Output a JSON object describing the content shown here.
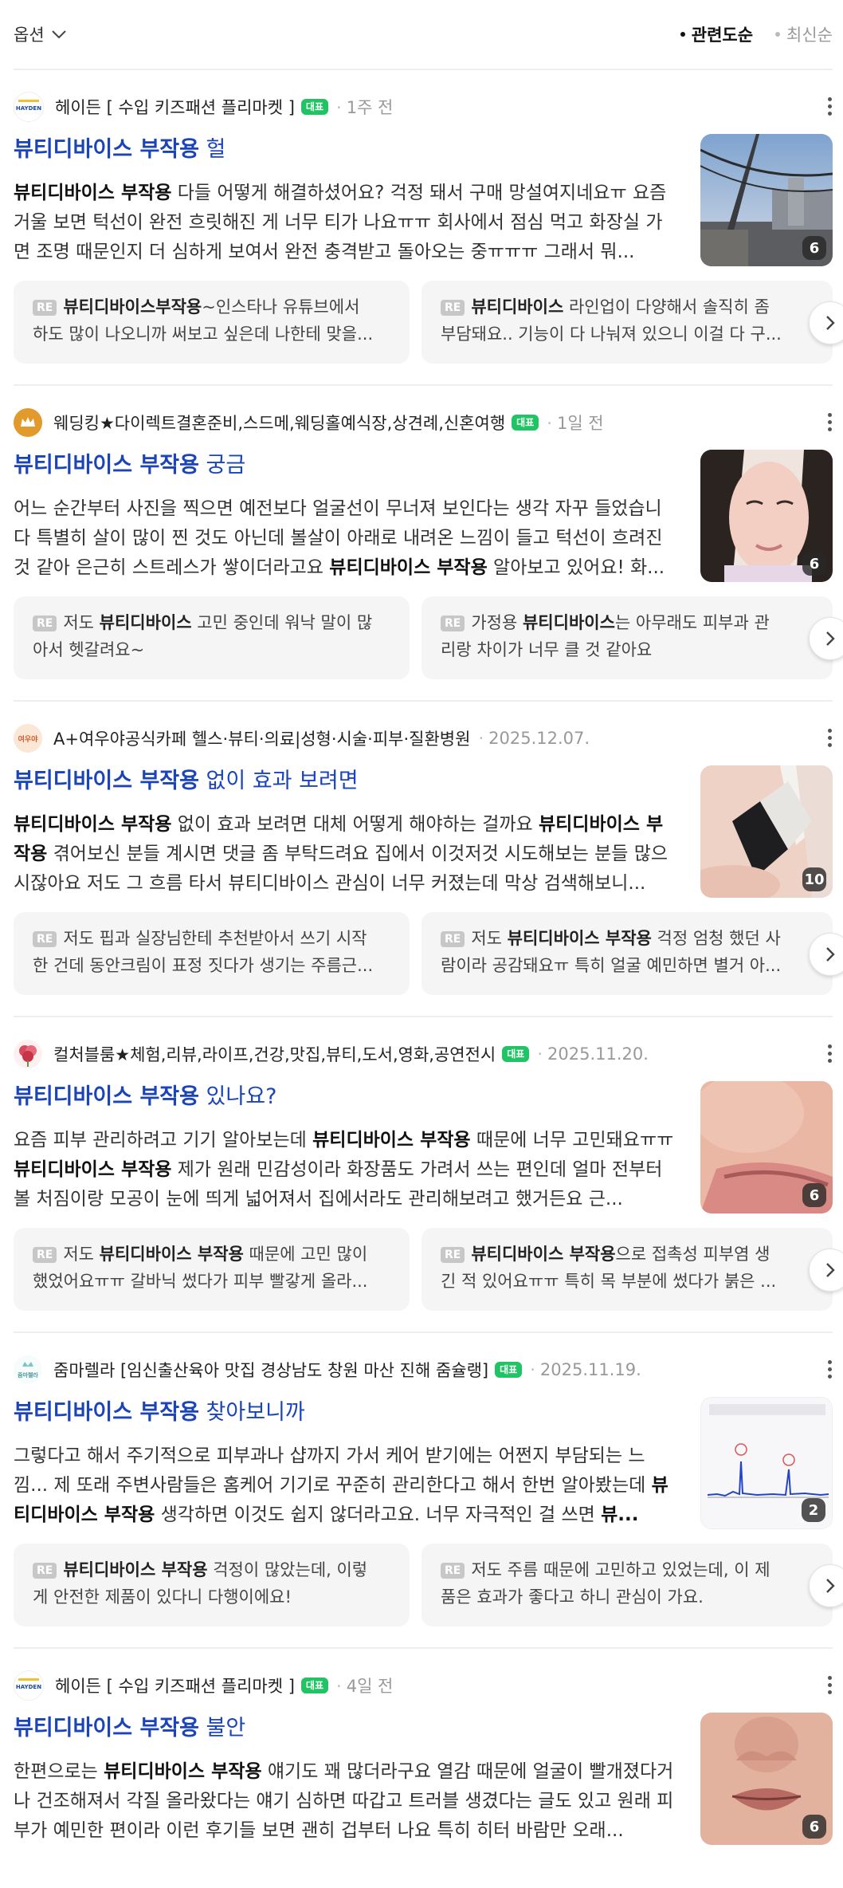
{
  "header": {
    "options_label": "옵션",
    "sort_relevance": "관련도순",
    "sort_latest": "최신순"
  },
  "icons": {
    "options_toggle": "chevron-down-icon",
    "more_menu": "more-vertical-icon",
    "next_arrow": "chevron-right-icon"
  },
  "colors": {
    "title_blue": "#1a44b8",
    "badge_green": "#21c464",
    "reply_bg": "#f5f5f5"
  },
  "cards": [
    {
      "source": "헤이든 [ 수입 키즈패션 플리마켓 ]",
      "avatar_text": "HAYDEN",
      "badge": "대표",
      "time": "1주 전",
      "title_bold": "뷰티디바이스 부작용",
      "title_rest": " 헐",
      "desc_html": "<b>뷰티디바이스 부작용</b> 다들 어떻게 해결하셨어요? 걱정 돼서 구매 망설여지네요ㅠ 요즘 거울 보면 턱선이 완전 흐릿해진 게 너무 티가 나요ㅠㅠ 회사에서 점심 먹고 화장실 가면 조명 때문인지 더 심하게 보여서 완전 충격받고 돌아오는 중ㅠㅠㅠ 그래서 뭐...",
      "image_count": "6",
      "reply1_l1_bold": "뷰티디바이스부작용",
      "reply1_l1_rest": "~인스타나 유튜브에서",
      "reply1_l2": "하도 많이 나오니까 써보고 싶은데 나한테 맞을...",
      "reply2_l1_bold": "뷰티디바이스",
      "reply2_l1_rest": " 라인업이 다양해서 솔직히 좀",
      "reply2_l2": "부담돼요.. 기능이 다 나눠져 있으니 이걸 다 구..."
    },
    {
      "source": "웨딩킹★다이렉트결혼준비,스드메,웨딩홀예식장,상견례,신혼여행",
      "avatar_text": "",
      "badge": "대표",
      "time": "1일 전",
      "title_bold": "뷰티디바이스 부작용",
      "title_rest": " 궁금",
      "desc_html": "어느 순간부터 사진을 찍으면 예전보다 얼굴선이 무너져 보인다는 생각 자꾸 들었습니다 특별히 살이 많이 찐 것도 아닌데 볼살이 아래로 내려온 느낌이 들고 턱선이 흐려진 것 같아 은근히 스트레스가 쌓이더라고요 <b>뷰티디바이스 부작용</b> 알아보고 있어요! 화...",
      "image_count": "6",
      "reply1_l1_bold": "뷰티디바이스",
      "reply1_l1_pre": "저도 ",
      "reply1_l1_rest": " 고민 중인데 워낙 말이 많",
      "reply1_l2": "아서 헷갈려요~",
      "reply2_l1_pre": "가정용 ",
      "reply2_l1_bold": "뷰티디바이스",
      "reply2_l1_rest": "는 아무래도 피부과 관",
      "reply2_l2": "리랑 차이가 너무 클 것 같아요"
    },
    {
      "source": "A+여우야공식카페 헬스·뷰티·의료|성형·시술·피부·질환병원",
      "avatar_text": "여우야",
      "badge": "",
      "time": "2025.12.07.",
      "title_bold": "뷰티디바이스 부작용",
      "title_rest": " 없이 효과 보려면",
      "desc_html": "<b>뷰티디바이스 부작용</b> 없이 효과 보려면 대체 어떻게 해야하는 걸까요 <b>뷰티디바이스 부작용</b> 겪어보신 분들 계시면 댓글 좀 부탁드려요 집에서 이것저것 시도해보는 분들 많으시잖아요 저도 그 흐름 타서 뷰티디바이스 관심이 너무 커졌는데 막상 검색해보니...",
      "image_count": "10",
      "reply1_l1_pre": "저도 핍과 실장님한테 추천받아서 쓰기 시작",
      "reply1_l2": "한 건데 동안크림이 표정 짓다가 생기는 주름근...",
      "reply2_l1_pre": "저도 ",
      "reply2_l1_bold": "뷰티디바이스 부작용",
      "reply2_l1_rest": " 걱정 엄청 했던 사",
      "reply2_l2": "람이라 공감돼요ㅠ 특히 얼굴 예민하면 별거 아..."
    },
    {
      "source": "컬처블룸★체험,리뷰,라이프,건강,맛집,뷰티,도서,영화,공연전시",
      "avatar_text": "",
      "badge": "대표",
      "time": "2025.11.20.",
      "title_bold": "뷰티디바이스 부작용",
      "title_rest": " 있나요?",
      "desc_html": "요즘 피부 관리하려고 기기 알아보는데 <b>뷰티디바이스 부작용</b> 때문에 너무 고민돼요ㅠㅠ <b>뷰티디바이스 부작용</b> 제가 원래 민감성이라 화장품도 가려서 쓰는 편인데 얼마 전부터 볼 처짐이랑 모공이 눈에 띄게 넓어져서 집에서라도 관리해보려고 했거든요 근...",
      "image_count": "6",
      "reply1_l1_pre": "저도 ",
      "reply1_l1_bold": "뷰티디바이스 부작용",
      "reply1_l1_rest": " 때문에 고민 많이",
      "reply1_l2": "했었어요ㅠㅠ 갈바닉 썼다가 피부 빨갛게 올라...",
      "reply2_l1_bold": "뷰티디바이스 부작용",
      "reply2_l1_rest": "으로 접촉성 피부염 생",
      "reply2_l2": "긴 적 있어요ㅠㅠ 특히 목 부분에 썼다가 붉은 ..."
    },
    {
      "source": "줌마렐라 [임신출산육아 맛집 경상남도 창원 마산 진해 줌슐랭]",
      "avatar_text": "줌마렐라",
      "badge": "대표",
      "time": "2025.11.19.",
      "title_bold": "뷰티디바이스 부작용",
      "title_rest": " 찾아보니까",
      "desc_html": "그렇다고 해서 주기적으로 피부과나 샵까지 가서 케어 받기에는 어쩐지 부담되는 느낌... 제 또래 주변사람들은 홈케어 기기로 꾸준히 관리한다고 해서 한번 알아봤는데 <b>뷰티디바이스 부작용</b> 생각하면 이것도 쉽지 않더라고요. 너무 자극적인 걸 쓰면 <b>뷰...</b>",
      "image_count": "2",
      "reply1_l1_bold": "뷰티디바이스 부작용",
      "reply1_l1_rest": " 걱정이 많았는데, 이렇",
      "reply1_l2": "게 안전한 제품이 있다니 다행이에요!",
      "reply2_l1_pre": "저도 주름 때문에 고민하고 있었는데, 이 제",
      "reply2_l2": "품은 효과가 좋다고 하니 관심이 가요."
    },
    {
      "source": "헤이든 [ 수입 키즈패션 플리마켓 ]",
      "avatar_text": "HAYDEN",
      "badge": "대표",
      "time": "4일 전",
      "title_bold": "뷰티디바이스 부작용",
      "title_rest": " 불안",
      "desc_html": "한편으로는 <b>뷰티디바이스 부작용</b> 얘기도 꽤 많더라구요 열감 때문에 얼굴이 빨개졌다거나 건조해져서 각질 올라왔다는 얘기 심하면 따갑고 트러블 생겼다는 글도 있고 원래 피부가 예민한 편이라 이런 후기들 보면 괜히 겁부터 나요 특히 히터 바람만 오래...",
      "image_count": "6"
    }
  ],
  "reply_tag": "RE"
}
